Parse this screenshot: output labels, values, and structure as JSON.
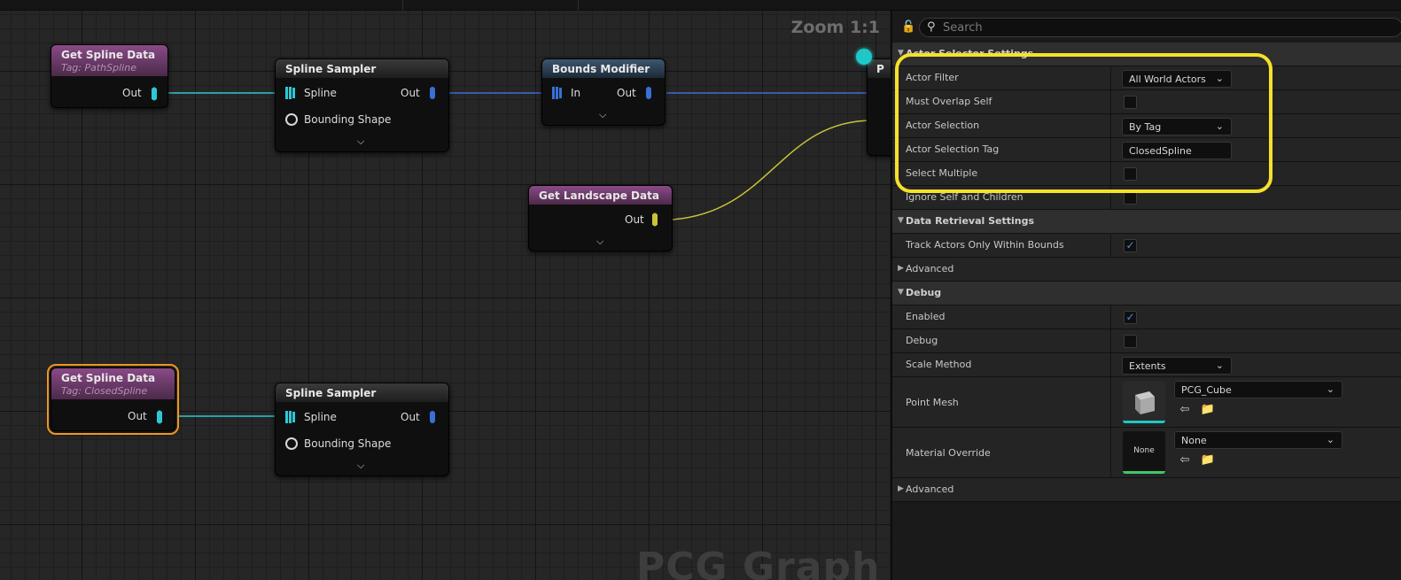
{
  "graph": {
    "zoom_label": "Zoom 1:1",
    "watermark": "PCG Graph",
    "nodes": {
      "get_spline_1": {
        "title": "Get Spline Data",
        "subtitle": "Tag: PathSpline",
        "out": "Out"
      },
      "spline_sampler_1": {
        "title": "Spline Sampler",
        "in_spline": "Spline",
        "in_bounding": "Bounding Shape",
        "out": "Out"
      },
      "bounds_modifier": {
        "title": "Bounds Modifier",
        "in": "In",
        "out": "Out"
      },
      "get_landscape": {
        "title": "Get Landscape Data",
        "out": "Out"
      },
      "get_spline_2": {
        "title": "Get Spline Data",
        "subtitle": "Tag: ClosedSpline",
        "out": "Out"
      },
      "spline_sampler_2": {
        "title": "Spline Sampler",
        "in_spline": "Spline",
        "in_bounding": "Bounding Shape",
        "out": "Out"
      }
    },
    "partial_node_letter": "P",
    "colors": {
      "spline_wire": "#2fc7d6",
      "point_wire": "#3b6fd6",
      "landscape_wire": "#c9c23a",
      "selection": "#f0961e"
    }
  },
  "details": {
    "search_placeholder": "Search",
    "sections": {
      "actor_selector": "Actor Selector Settings",
      "data_retrieval": "Data Retrieval Settings",
      "advanced_1": "Advanced",
      "debug": "Debug",
      "advanced_2": "Advanced"
    },
    "actor_filter": {
      "label": "Actor Filter",
      "value": "All World Actors"
    },
    "must_overlap_self": {
      "label": "Must Overlap Self",
      "checked": false
    },
    "actor_selection": {
      "label": "Actor Selection",
      "value": "By Tag"
    },
    "actor_selection_tag": {
      "label": "Actor Selection Tag",
      "value": "ClosedSpline"
    },
    "select_multiple": {
      "label": "Select Multiple",
      "checked": false
    },
    "ignore_self": {
      "label": "Ignore Self and Children",
      "checked": false
    },
    "track_actors": {
      "label": "Track Actors Only Within Bounds",
      "checked": true
    },
    "enabled": {
      "label": "Enabled",
      "checked": true
    },
    "debug_flag": {
      "label": "Debug",
      "checked": false
    },
    "scale_method": {
      "label": "Scale Method",
      "value": "Extents"
    },
    "point_mesh": {
      "label": "Point Mesh",
      "value": "PCG_Cube"
    },
    "material_override": {
      "label": "Material Override",
      "value": "None",
      "thumb_text": "None"
    },
    "highlight_color": "#f5e12a"
  }
}
